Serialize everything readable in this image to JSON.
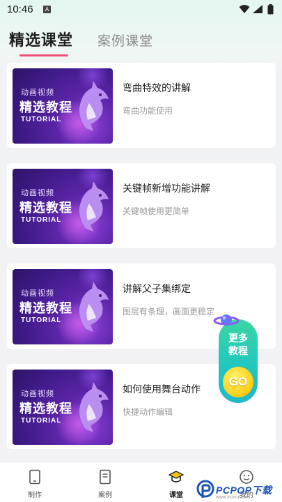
{
  "status_bar": {
    "time": "10:46",
    "notification_letter": "A"
  },
  "tabs": [
    {
      "label": "精选课堂",
      "active": true
    },
    {
      "label": "案例课堂",
      "active": false
    }
  ],
  "accent_color": "#f04f78",
  "thumbnail": {
    "subtitle": "动画视频",
    "title": "精选教程",
    "english": "TUTORIAL"
  },
  "courses": [
    {
      "title": "弯曲特效的讲解",
      "description": "弯曲功能使用"
    },
    {
      "title": "关键帧新增功能讲解",
      "description": "关键帧使用更简单"
    },
    {
      "title": "讲解父子集绑定",
      "description": "图层有条理，画面更稳定"
    },
    {
      "title": "如何使用舞台动作",
      "description": "快捷动作编辑"
    }
  ],
  "float_button": {
    "line1": "更多",
    "line2": "教程",
    "go": "GO"
  },
  "bottom_nav": [
    {
      "label": "制作",
      "icon": "tablet-icon",
      "active": false
    },
    {
      "label": "案例",
      "icon": "document-icon",
      "active": false
    },
    {
      "label": "课堂",
      "icon": "graduation-cap-icon",
      "active": true
    },
    {
      "label": "我的",
      "icon": "smiley-face-icon",
      "active": false
    }
  ],
  "watermark": {
    "text": "PCPOP下载",
    "subtext": "WWW.PCPOP.COM"
  }
}
